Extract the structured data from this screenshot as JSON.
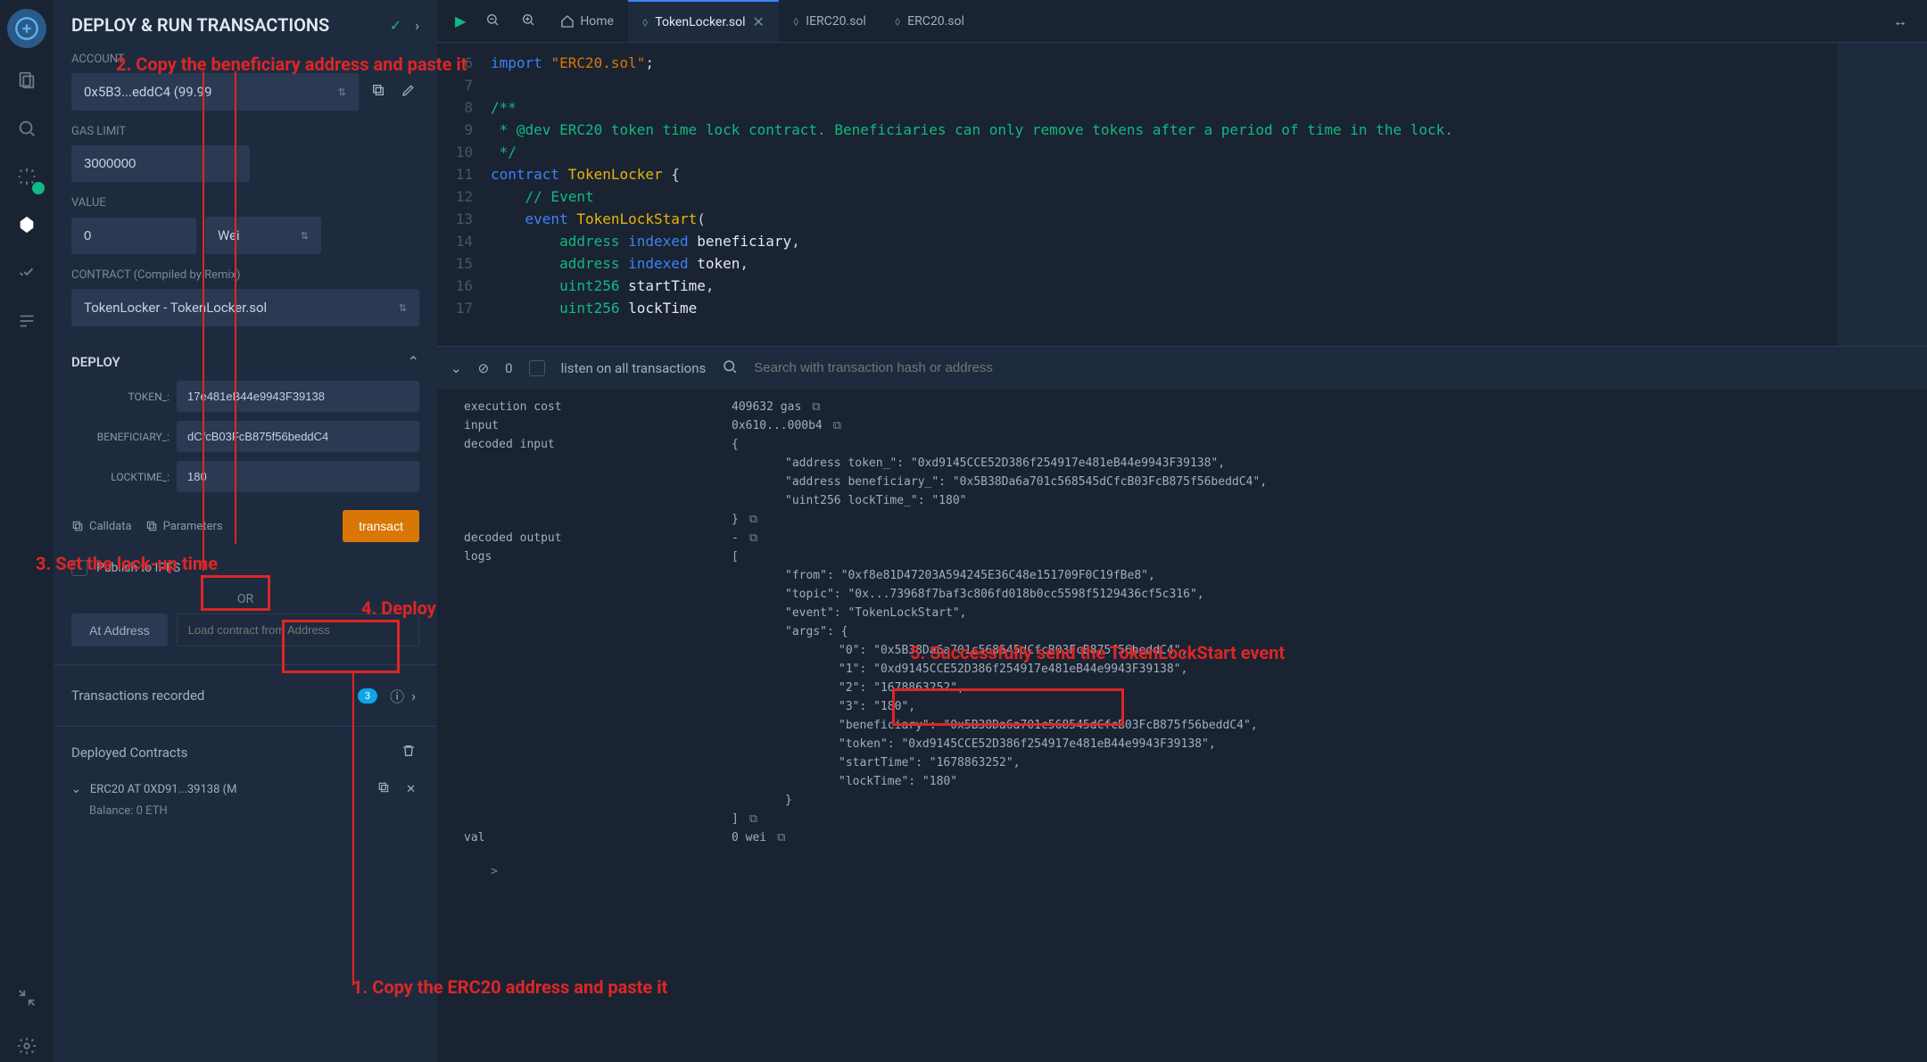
{
  "sidepanel": {
    "title": "DEPLOY & RUN TRANSACTIONS",
    "account_label": "ACCOUNT",
    "account_value": "0x5B3...eddC4 (99.99",
    "gas_label": "GAS LIMIT",
    "gas_value": "3000000",
    "value_label": "VALUE",
    "value_value": "0",
    "value_unit": "Wei",
    "contract_label": "CONTRACT (Compiled by Remix)",
    "contract_sel": "TokenLocker - TokenLocker.sol",
    "deploy_label": "DEPLOY",
    "params": [
      {
        "label": "TOKEN_:",
        "value": "17e481eB44e9943F39138"
      },
      {
        "label": "BENEFICIARY_:",
        "value": "dCfcB03FcB875f56beddC4"
      },
      {
        "label": "LOCKTIME_:",
        "value": "180"
      }
    ],
    "calldata": "Calldata",
    "parameters": "Parameters",
    "transact": "transact",
    "publish": "Publish to IPFS",
    "or": "OR",
    "ataddr": "At Address",
    "loadaddr_ph": "Load contract from Address",
    "txrec": "Transactions recorded",
    "txcount": "3",
    "depcon": "Deployed Contracts",
    "depitem": "ERC20 AT 0XD91...39138 (M",
    "balance": "Balance: 0 ETH"
  },
  "tabs": {
    "home": "Home",
    "list": [
      {
        "name": "TokenLocker.sol",
        "active": true
      },
      {
        "name": "IERC20.sol",
        "active": false
      },
      {
        "name": "ERC20.sol",
        "active": false
      }
    ]
  },
  "code": {
    "lines": [
      {
        "n": 6,
        "html": "<span class='kw'>import</span> <span class='str'>\"ERC20.sol\"</span>;"
      },
      {
        "n": 7,
        "html": ""
      },
      {
        "n": 8,
        "html": "<span class='cmt'>/**</span>"
      },
      {
        "n": 9,
        "html": "<span class='cmt'> * @dev ERC20 token time lock contract. Beneficiaries can only remove tokens after a period of time in the lock.</span>"
      },
      {
        "n": 10,
        "html": "<span class='cmt'> */</span>"
      },
      {
        "n": 11,
        "html": "<span class='kw'>contract</span> <span class='fn'>TokenLocker</span> {"
      },
      {
        "n": 12,
        "html": "    <span class='cmt'>// Event</span>"
      },
      {
        "n": 13,
        "html": "    <span class='kw'>event</span> <span class='fn'>TokenLockStart</span>("
      },
      {
        "n": 14,
        "html": "        <span class='typ'>address</span> <span class='kw'>indexed</span> <span class='id'>beneficiary</span>,"
      },
      {
        "n": 15,
        "html": "        <span class='typ'>address</span> <span class='kw'>indexed</span> <span class='id'>token</span>,"
      },
      {
        "n": 16,
        "html": "        <span class='typ'>uint256</span> <span class='id'>startTime</span>,"
      },
      {
        "n": 17,
        "html": "        <span class='typ'>uint256</span> <span class='id'>lockTime</span>"
      }
    ]
  },
  "termbar": {
    "zero": "0",
    "listen": "listen on all transactions",
    "search_ph": "Search with transaction hash or address"
  },
  "terminal": {
    "rows": [
      {
        "k": "execution cost",
        "v": "409632 gas",
        "copy": true
      },
      {
        "k": "input",
        "v": "0x610...000b4",
        "copy": true
      },
      {
        "k": "decoded input",
        "v": "{",
        "copy": false
      },
      {
        "json": "\"address token_\": \"0xd9145CCE52D386f254917e481eB44e9943F39138\","
      },
      {
        "json": "\"address beneficiary_\": \"0x5B38Da6a701c568545dCfcB03FcB875f56beddC4\","
      },
      {
        "json": "\"uint256 lockTime_\": \"180\""
      },
      {
        "close": "}",
        "copy": true
      },
      {
        "k": "decoded output",
        "v": "-",
        "copy": true
      },
      {
        "k": "logs",
        "v": "[",
        "copy": false
      },
      {
        "json": "\"from\": \"0xf8e81D47203A594245E36C48e151709F0C19fBe8\","
      },
      {
        "json": "\"topic\": \"0x...73968f7baf3c806fd018b0cc5598f5129436cf5c316\","
      },
      {
        "json": "\"event\": \"TokenLockStart\","
      },
      {
        "json": "\"args\": {"
      },
      {
        "json2": "\"0\": \"0x5B38Da6a701c568545dCfcB03FcB875f56beddC4\","
      },
      {
        "json2": "\"1\": \"0xd9145CCE52D386f254917e481eB44e9943F39138\","
      },
      {
        "json2": "\"2\": \"1678863252\","
      },
      {
        "json2": "\"3\": \"180\","
      },
      {
        "json2": "\"beneficiary\": \"0x5B38Da6a701c568545dCfcB03FcB875f56beddC4\","
      },
      {
        "json2": "\"token\": \"0xd9145CCE52D386f254917e481eB44e9943F39138\","
      },
      {
        "json2": "\"startTime\": \"1678863252\","
      },
      {
        "json2": "\"lockTime\": \"180\""
      },
      {
        "json": "}"
      },
      {
        "close": "]",
        "copy": true
      },
      {
        "k": "val",
        "v": "0 wei",
        "copy": true
      }
    ],
    "prompt": ">"
  },
  "annotations": {
    "a1": "1. Copy the ERC20 address and paste it",
    "a2": "2. Copy the beneficiary address and paste it",
    "a3": "3. Set the lock-up time",
    "a4": "4. Deploy",
    "a5": "5. Successfully send the TokenLockStart event"
  }
}
